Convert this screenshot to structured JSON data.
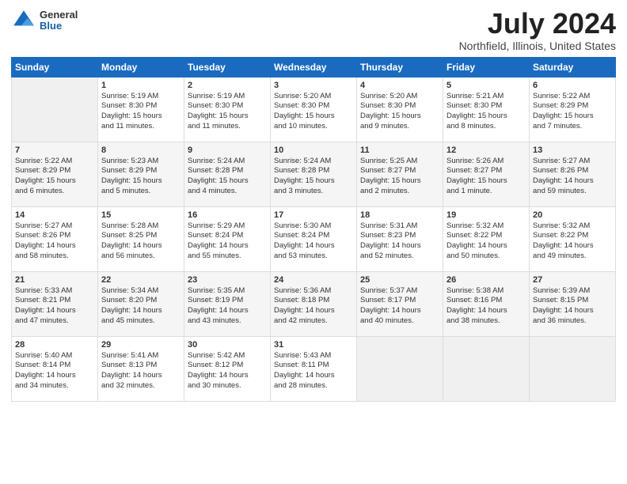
{
  "header": {
    "logo_general": "General",
    "logo_blue": "Blue",
    "title": "July 2024",
    "location": "Northfield, Illinois, United States"
  },
  "days_of_week": [
    "Sunday",
    "Monday",
    "Tuesday",
    "Wednesday",
    "Thursday",
    "Friday",
    "Saturday"
  ],
  "weeks": [
    [
      {
        "day": "",
        "info": ""
      },
      {
        "day": "1",
        "info": "Sunrise: 5:19 AM\nSunset: 8:30 PM\nDaylight: 15 hours\nand 11 minutes."
      },
      {
        "day": "2",
        "info": "Sunrise: 5:19 AM\nSunset: 8:30 PM\nDaylight: 15 hours\nand 11 minutes."
      },
      {
        "day": "3",
        "info": "Sunrise: 5:20 AM\nSunset: 8:30 PM\nDaylight: 15 hours\nand 10 minutes."
      },
      {
        "day": "4",
        "info": "Sunrise: 5:20 AM\nSunset: 8:30 PM\nDaylight: 15 hours\nand 9 minutes."
      },
      {
        "day": "5",
        "info": "Sunrise: 5:21 AM\nSunset: 8:30 PM\nDaylight: 15 hours\nand 8 minutes."
      },
      {
        "day": "6",
        "info": "Sunrise: 5:22 AM\nSunset: 8:29 PM\nDaylight: 15 hours\nand 7 minutes."
      }
    ],
    [
      {
        "day": "7",
        "info": "Sunrise: 5:22 AM\nSunset: 8:29 PM\nDaylight: 15 hours\nand 6 minutes."
      },
      {
        "day": "8",
        "info": "Sunrise: 5:23 AM\nSunset: 8:29 PM\nDaylight: 15 hours\nand 5 minutes."
      },
      {
        "day": "9",
        "info": "Sunrise: 5:24 AM\nSunset: 8:28 PM\nDaylight: 15 hours\nand 4 minutes."
      },
      {
        "day": "10",
        "info": "Sunrise: 5:24 AM\nSunset: 8:28 PM\nDaylight: 15 hours\nand 3 minutes."
      },
      {
        "day": "11",
        "info": "Sunrise: 5:25 AM\nSunset: 8:27 PM\nDaylight: 15 hours\nand 2 minutes."
      },
      {
        "day": "12",
        "info": "Sunrise: 5:26 AM\nSunset: 8:27 PM\nDaylight: 15 hours\nand 1 minute."
      },
      {
        "day": "13",
        "info": "Sunrise: 5:27 AM\nSunset: 8:26 PM\nDaylight: 14 hours\nand 59 minutes."
      }
    ],
    [
      {
        "day": "14",
        "info": "Sunrise: 5:27 AM\nSunset: 8:26 PM\nDaylight: 14 hours\nand 58 minutes."
      },
      {
        "day": "15",
        "info": "Sunrise: 5:28 AM\nSunset: 8:25 PM\nDaylight: 14 hours\nand 56 minutes."
      },
      {
        "day": "16",
        "info": "Sunrise: 5:29 AM\nSunset: 8:24 PM\nDaylight: 14 hours\nand 55 minutes."
      },
      {
        "day": "17",
        "info": "Sunrise: 5:30 AM\nSunset: 8:24 PM\nDaylight: 14 hours\nand 53 minutes."
      },
      {
        "day": "18",
        "info": "Sunrise: 5:31 AM\nSunset: 8:23 PM\nDaylight: 14 hours\nand 52 minutes."
      },
      {
        "day": "19",
        "info": "Sunrise: 5:32 AM\nSunset: 8:22 PM\nDaylight: 14 hours\nand 50 minutes."
      },
      {
        "day": "20",
        "info": "Sunrise: 5:32 AM\nSunset: 8:22 PM\nDaylight: 14 hours\nand 49 minutes."
      }
    ],
    [
      {
        "day": "21",
        "info": "Sunrise: 5:33 AM\nSunset: 8:21 PM\nDaylight: 14 hours\nand 47 minutes."
      },
      {
        "day": "22",
        "info": "Sunrise: 5:34 AM\nSunset: 8:20 PM\nDaylight: 14 hours\nand 45 minutes."
      },
      {
        "day": "23",
        "info": "Sunrise: 5:35 AM\nSunset: 8:19 PM\nDaylight: 14 hours\nand 43 minutes."
      },
      {
        "day": "24",
        "info": "Sunrise: 5:36 AM\nSunset: 8:18 PM\nDaylight: 14 hours\nand 42 minutes."
      },
      {
        "day": "25",
        "info": "Sunrise: 5:37 AM\nSunset: 8:17 PM\nDaylight: 14 hours\nand 40 minutes."
      },
      {
        "day": "26",
        "info": "Sunrise: 5:38 AM\nSunset: 8:16 PM\nDaylight: 14 hours\nand 38 minutes."
      },
      {
        "day": "27",
        "info": "Sunrise: 5:39 AM\nSunset: 8:15 PM\nDaylight: 14 hours\nand 36 minutes."
      }
    ],
    [
      {
        "day": "28",
        "info": "Sunrise: 5:40 AM\nSunset: 8:14 PM\nDaylight: 14 hours\nand 34 minutes."
      },
      {
        "day": "29",
        "info": "Sunrise: 5:41 AM\nSunset: 8:13 PM\nDaylight: 14 hours\nand 32 minutes."
      },
      {
        "day": "30",
        "info": "Sunrise: 5:42 AM\nSunset: 8:12 PM\nDaylight: 14 hours\nand 30 minutes."
      },
      {
        "day": "31",
        "info": "Sunrise: 5:43 AM\nSunset: 8:11 PM\nDaylight: 14 hours\nand 28 minutes."
      },
      {
        "day": "",
        "info": ""
      },
      {
        "day": "",
        "info": ""
      },
      {
        "day": "",
        "info": ""
      }
    ]
  ]
}
